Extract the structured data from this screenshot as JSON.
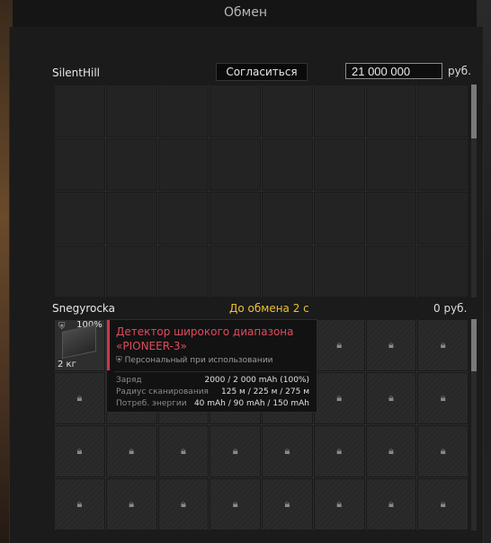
{
  "window": {
    "title": "Обмен"
  },
  "top_player": {
    "name": "SilentHill",
    "agree_label": "Согласиться",
    "money_value": "21 000 000",
    "currency": "руб."
  },
  "bottom_player": {
    "name": "Snegyrocka",
    "timer": "До обмена 2 с",
    "money_display": "0 руб."
  },
  "item": {
    "condition": "100%",
    "weight": "2 кг",
    "title": "Детектор широкого диапазона «PIONEER-3»",
    "binding": "Персональный при использовании",
    "stats": [
      {
        "label": "Заряд",
        "value": "2000 / 2 000 mAh (100%)"
      },
      {
        "label": "Радиус сканирования",
        "value": "125 м / 225 м / 275 м"
      },
      {
        "label": "Потреб. энергии",
        "value": "40 mAh / 90 mAh / 150 mAh"
      }
    ]
  },
  "icons": {
    "lock": "lock-icon",
    "shield": "shield-icon"
  },
  "colors": {
    "accent_red": "#e04a5e",
    "timer_yellow": "#f0c030"
  }
}
